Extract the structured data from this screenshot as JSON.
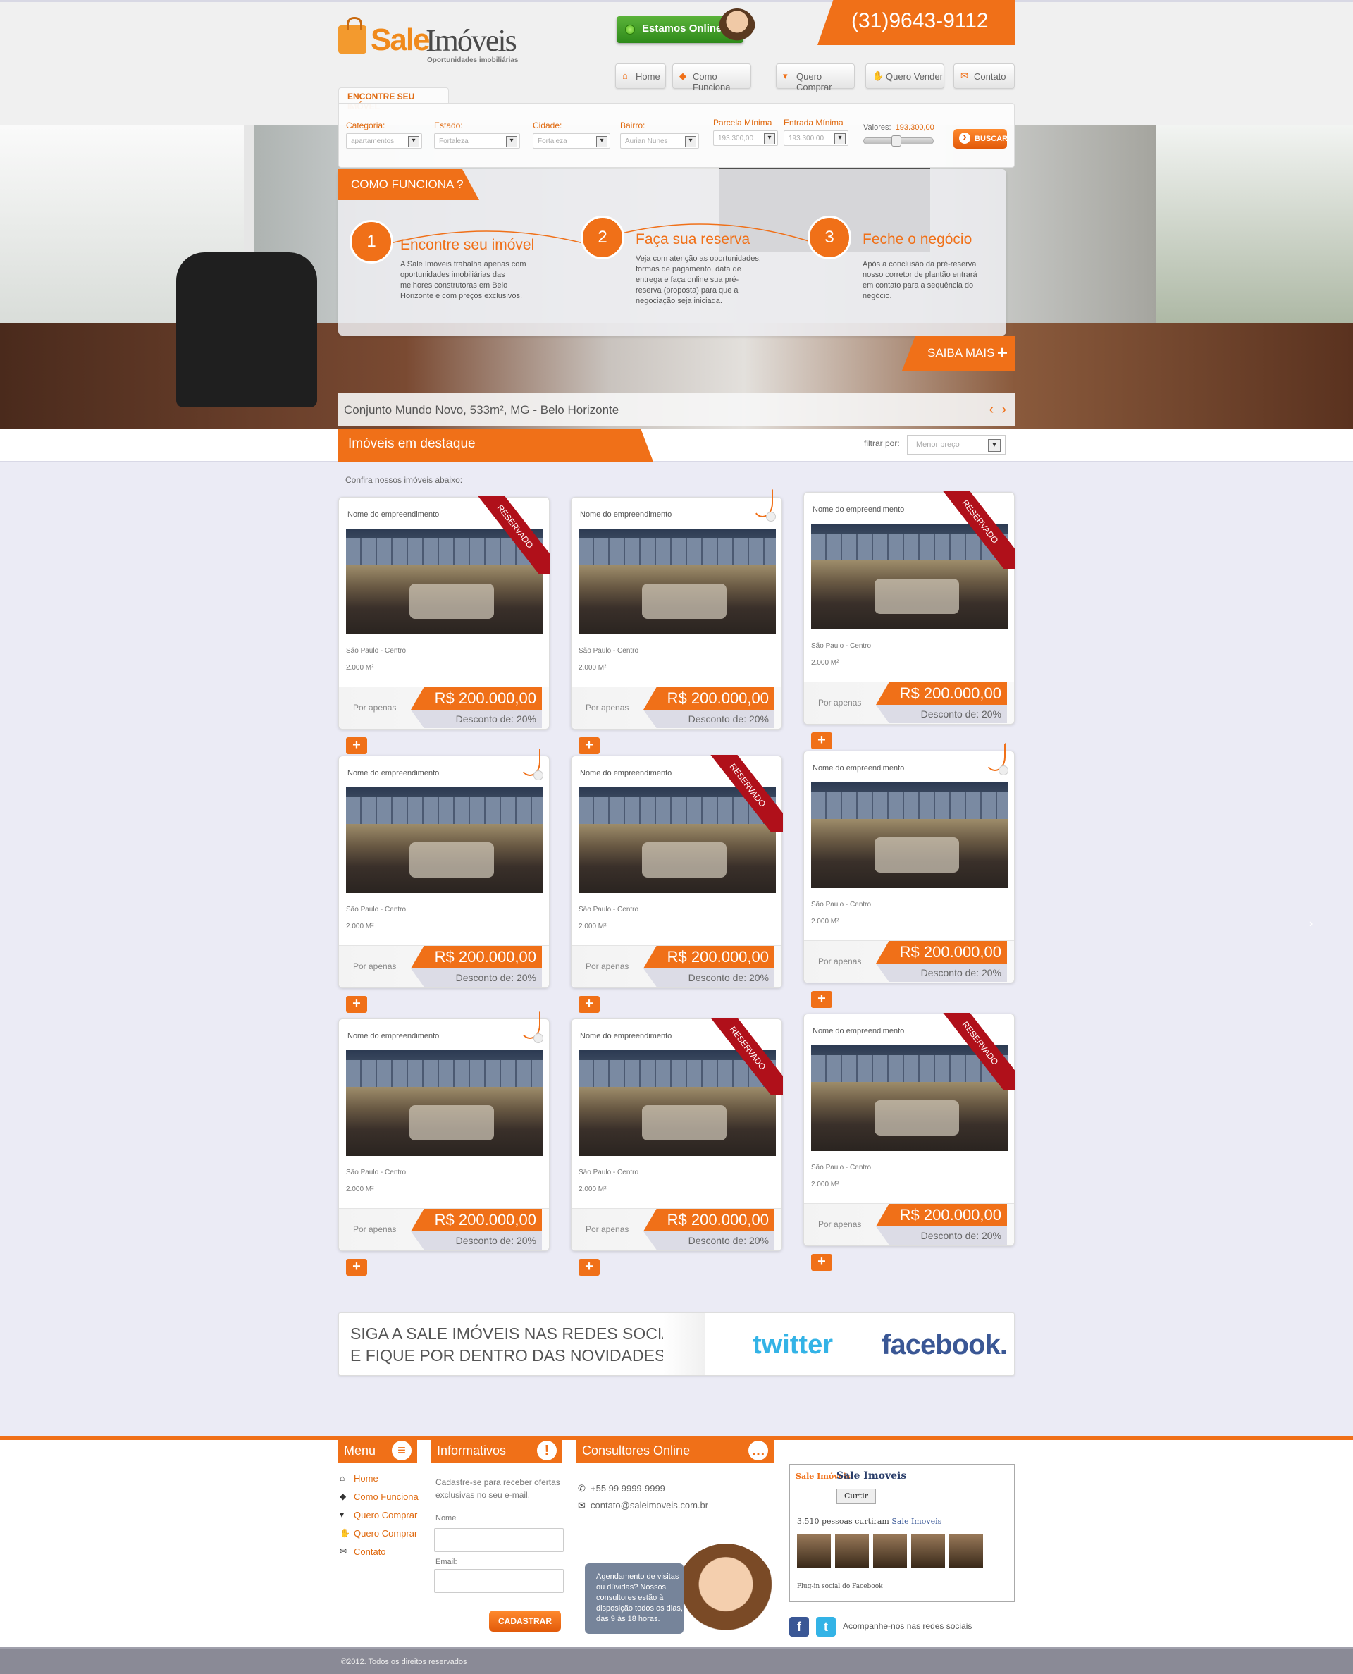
{
  "brand": {
    "name_part1": "Sale",
    "name_part2": "Imóveis",
    "tagline": "Oportunidades imobiliárias"
  },
  "header": {
    "online_label": "Estamos Online",
    "phone": "(31)9643-9112"
  },
  "nav": [
    {
      "label": "Home",
      "icon": "home-icon"
    },
    {
      "label": "Como Funciona",
      "icon": "tag-icon"
    },
    {
      "label": "Quero Comprar",
      "icon": "cart-icon"
    },
    {
      "label": "Quero Vender",
      "icon": "thumbs-up-icon"
    },
    {
      "label": "Contato",
      "icon": "mail-icon"
    }
  ],
  "search": {
    "tab_label": "ENCONTRE SEU IMÓVEL",
    "fields": [
      {
        "label": "Categoria:",
        "value": "apartamentos"
      },
      {
        "label": "Estado:",
        "value": "Fortaleza"
      },
      {
        "label": "Cidade:",
        "value": "Fortaleza"
      },
      {
        "label": "Bairro:",
        "value": "Aurian Nunes"
      },
      {
        "label": "Parcela Mínima",
        "value": "193.300,00"
      },
      {
        "label": "Entrada Mínima",
        "value": "193.300,00"
      }
    ],
    "valores_label": "Valores:",
    "valores_value": "193.300,00",
    "slider_position": 0.45,
    "buscar_label": "BUSCAR"
  },
  "how": {
    "tab_label": "COMO FUNCIONA ?",
    "steps": [
      {
        "num": "1",
        "title": "Encontre seu imóvel",
        "text": "A Sale Imóveis trabalha apenas com oportunidades imobiliárias das melhores construtoras em Belo Horizonte e com preços exclusivos."
      },
      {
        "num": "2",
        "title": "Faça sua reserva",
        "text": "Veja com atenção as oportunidades, formas de pagamento, data de entrega e faça online sua pré-reserva (proposta) para que a negociação seja iniciada."
      },
      {
        "num": "3",
        "title": "Feche o negócio",
        "text": "Após a conclusão da pré-reserva nosso corretor de plantão entrará em contato para a sequência do negócio."
      }
    ],
    "saiba_label": "SAIBA MAIS"
  },
  "hero": {
    "caption": "Conjunto Mundo Novo, 533m²,  MG - Belo Horizonte"
  },
  "featured": {
    "title": "Imóveis em destaque",
    "filter_label": "filtrar por:",
    "filter_value": "Menor preço",
    "intro": "Confira nossos imóveis abaixo:"
  },
  "listing_template": {
    "name": "Nome do empreendimento",
    "location": "São Paulo -  Centro",
    "area": "2.000 M²",
    "por_apenas": "Por apenas",
    "price": "R$ 200.000,00",
    "discount": "Desconto de: 20%",
    "reserved_label": "RESERVADO"
  },
  "listings": [
    {
      "reserved": true
    },
    {
      "reserved": false
    },
    {
      "reserved": true
    },
    {
      "reserved": false
    },
    {
      "reserved": true
    },
    {
      "reserved": false
    },
    {
      "reserved": false
    },
    {
      "reserved": true
    },
    {
      "reserved": true
    }
  ],
  "social": {
    "line1": "SIGA A SALE IMÓVEIS NAS REDES SOCIAIS",
    "line2": "E FIQUE POR DENTRO DAS NOVIDADES.",
    "twitter": "twitter",
    "facebook": "facebook."
  },
  "footer": {
    "menu_title": "Menu",
    "menu": [
      {
        "label": "Home",
        "icon": "home-icon"
      },
      {
        "label": "Como Funciona",
        "icon": "tag-icon"
      },
      {
        "label": "Quero Comprar",
        "icon": "cart-icon"
      },
      {
        "label": "Quero Comprar",
        "icon": "thumbs-up-icon"
      },
      {
        "label": "Contato",
        "icon": "mail-icon"
      }
    ],
    "info_title": "Informativos",
    "info_text": "Cadastre-se para receber ofertas exclusivas no seu e-mail.",
    "name_label": "Nome",
    "email_label": "Email:",
    "cadastrar_label": "CADASTRAR",
    "consult_title": "Consultores Online",
    "phone": "+55  99 9999-9999",
    "email": "contato@saleimoveis.com.br",
    "bubble": "Agendamento de visitas ou dúvidas? Nossos consultores estão à disposição todos os dias, das 9 às 18 horas.",
    "fb_page": "Sale Imoveis",
    "fb_like": "Curtir",
    "fb_count_prefix": "3.510 pessoas curtiram",
    "fb_count_page": "Sale Imoveis",
    "fb_plugin": "Plug-in social do Facebook",
    "follow_text": "Acompanhe-nos nas redes sociais",
    "copyright": "©2012. Todos os direitos reservados"
  },
  "colors": {
    "accent": "#f07018",
    "reserved": "#b0101a",
    "online": "#3ea02a",
    "twitter": "#33b3e6",
    "facebook": "#3a5795"
  }
}
